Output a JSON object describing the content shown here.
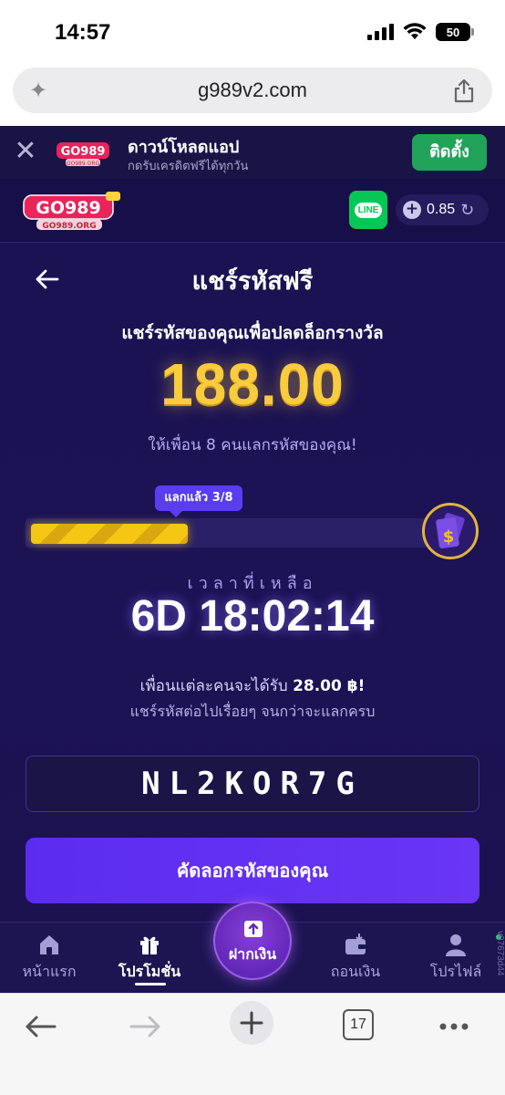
{
  "status_bar": {
    "time": "14:57",
    "battery": "50"
  },
  "browser": {
    "url": "g989v2.com",
    "tabs_count": "17"
  },
  "app_banner": {
    "title": "ดาวน์โหลดแอป",
    "subtitle": "กดรับเครดิตฟรีได้ทุกวัน",
    "install_label": "ติดตั้ง"
  },
  "header": {
    "line_label": "LINE",
    "balance": "0.85"
  },
  "promo": {
    "title": "แชร์รหัสฟรี",
    "subtitle": "แชร์รหัสของคุณเพื่อปลดล็อกรางวัล",
    "amount": "188.00",
    "invite_text": "ให้เพื่อน 8 คนแลกรหัสของคุณ!",
    "claimed_label": "แลกแล้ว 3/8",
    "progress": {
      "claimed": 3,
      "total": 8
    },
    "time_label": "เวลาที่เหลือ",
    "countdown": "6D 18:02:14",
    "per_friend": "เพื่อนแต่ละคนจะได้รับ",
    "per_friend_amount": "28.00 ฿!",
    "keep_sharing": "แชร์รหัสต่อไปเรื่อยๆ จนกว่าจะแลกครบ",
    "code": "NL2KOR7G",
    "copy_button": "คัดลอกรหัสของคุณ"
  },
  "bottom_nav": {
    "items": [
      {
        "label": "หน้าแรก",
        "icon": "home-icon"
      },
      {
        "label": "โปรโมชั่น",
        "icon": "gift-icon"
      },
      {
        "label": "ฝากเงิน",
        "icon": "deposit-icon"
      },
      {
        "label": "ถอนเงิน",
        "icon": "wallet-icon"
      },
      {
        "label": "โปรไฟล์",
        "icon": "profile-icon"
      }
    ],
    "version": "v07673d44"
  },
  "colors": {
    "background": "#1a1252",
    "accent": "#5b2cf0",
    "gold": "#f8cc3c",
    "install_green": "#22a35a",
    "line_green": "#06c755"
  }
}
